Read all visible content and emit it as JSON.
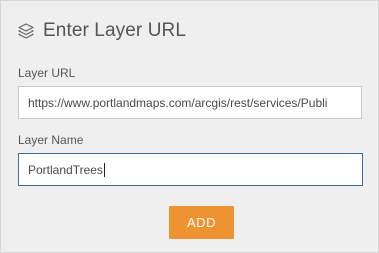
{
  "header": {
    "icon": "layers-icon",
    "title": "Enter Layer URL"
  },
  "form": {
    "url_label": "Layer URL",
    "url_value": "https://www.portlandmaps.com/arcgis/rest/services/Publi",
    "name_label": "Layer Name",
    "name_value": "PortlandTrees"
  },
  "actions": {
    "add_label": "ADD"
  },
  "colors": {
    "panel_background": "#efefef",
    "accent_button": "#ee9331",
    "focused_border": "#3d6e99"
  }
}
